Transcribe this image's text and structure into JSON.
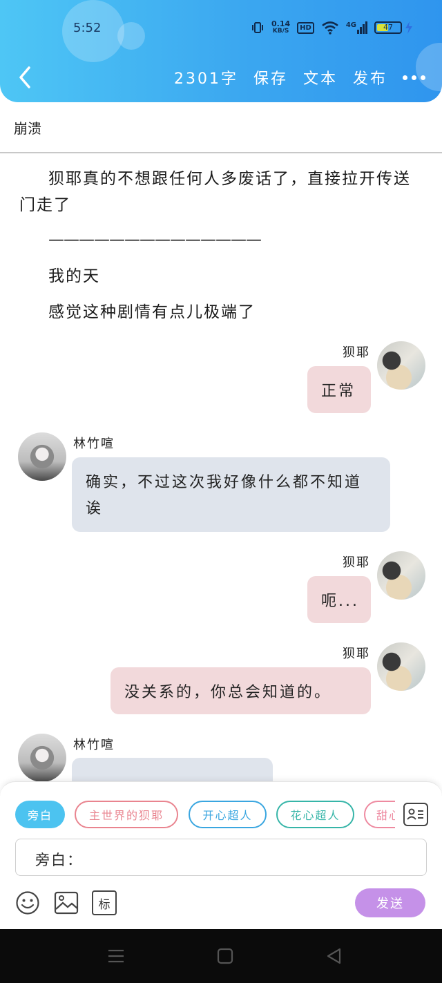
{
  "status_bar": {
    "time": "5:52",
    "net_speed_value": "0.14",
    "net_speed_unit": "KB/S",
    "hd_label": "HD",
    "network_type": "4G",
    "battery_level": "47"
  },
  "header": {
    "word_count": "2301字",
    "save_label": "保存",
    "text_label": "文本",
    "publish_label": "发布"
  },
  "chapter": {
    "title": "崩溃"
  },
  "narration": [
    "狈耶真的不想跟任何人多废话了，直接拉开传送门走了",
    "——————————————",
    "我的天",
    "感觉这种剧情有点儿极端了"
  ],
  "messages": [
    {
      "speaker": "狈耶",
      "text": "正常",
      "side": "right"
    },
    {
      "speaker": "林竹喧",
      "text": "确实，不过这次我好像什么都不知道诶",
      "side": "left"
    },
    {
      "speaker": "狈耶",
      "text": "呃...",
      "side": "right"
    },
    {
      "speaker": "狈耶",
      "text": "没关系的，你总会知道的。",
      "side": "right"
    },
    {
      "speaker": "林竹喧",
      "text": "…",
      "side": "left"
    }
  ],
  "composer": {
    "roles": [
      "旁白",
      "主世界的狈耶",
      "开心超人",
      "花心超人",
      "甜心超人"
    ],
    "input_label": "旁白：",
    "tool_tag_label": "标",
    "send_label": "发送"
  },
  "colors": {
    "header_gradient_start": "#4ec6f5",
    "header_gradient_end": "#2f95ee",
    "bubble_right": "#f2d9db",
    "bubble_left": "#dfe4ec",
    "send_button": "#c591e8",
    "active_chip": "#4cc3f0"
  }
}
